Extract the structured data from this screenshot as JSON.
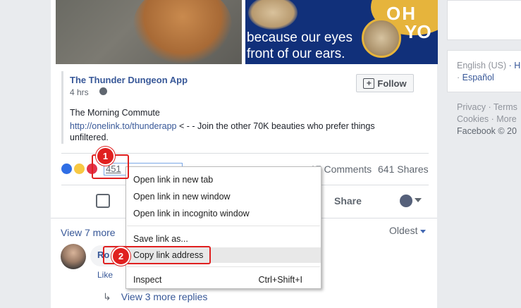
{
  "post": {
    "image2_caption_line1": "because our eyes",
    "image2_caption_line2": "front of our ears.",
    "image2_text_top": "OH",
    "image2_text_right": "YO",
    "page_name": "The Thunder Dungeon App",
    "time": "4 hrs",
    "follow_label": "Follow",
    "title": "The Morning Commute",
    "link": "http://onelink.to/thunderapp",
    "body": " < - - Join the other 70K beauties who prefer things unfiltered.",
    "reaction_count": "451",
    "comments": "17 Comments",
    "shares": "641 Shares",
    "share_label": "Share",
    "view_more": "View 7 more",
    "sort": "Oldest",
    "commenter_short": "Ro",
    "like_label": "Like",
    "more_replies": "View 3 more replies"
  },
  "sidebar": {
    "lang_current": "English (US)",
    "lang_sep": " · H",
    "lang_alt": "Español",
    "footer": [
      "Privacy · Terms",
      "Cookies · More",
      "Facebook © 20"
    ]
  },
  "context_menu": {
    "items": [
      {
        "label": "Open link in new tab",
        "shortcut": ""
      },
      {
        "label": "Open link in new window",
        "shortcut": ""
      },
      {
        "label": "Open link in incognito window",
        "shortcut": ""
      },
      {
        "label": "Save link as...",
        "shortcut": ""
      },
      {
        "label": "Copy link address",
        "shortcut": ""
      },
      {
        "label": "Inspect",
        "shortcut": "Ctrl+Shift+I"
      }
    ],
    "highlighted_index": 4
  },
  "annotations": {
    "step1": "1",
    "step2": "2",
    "color": "#e02020"
  }
}
